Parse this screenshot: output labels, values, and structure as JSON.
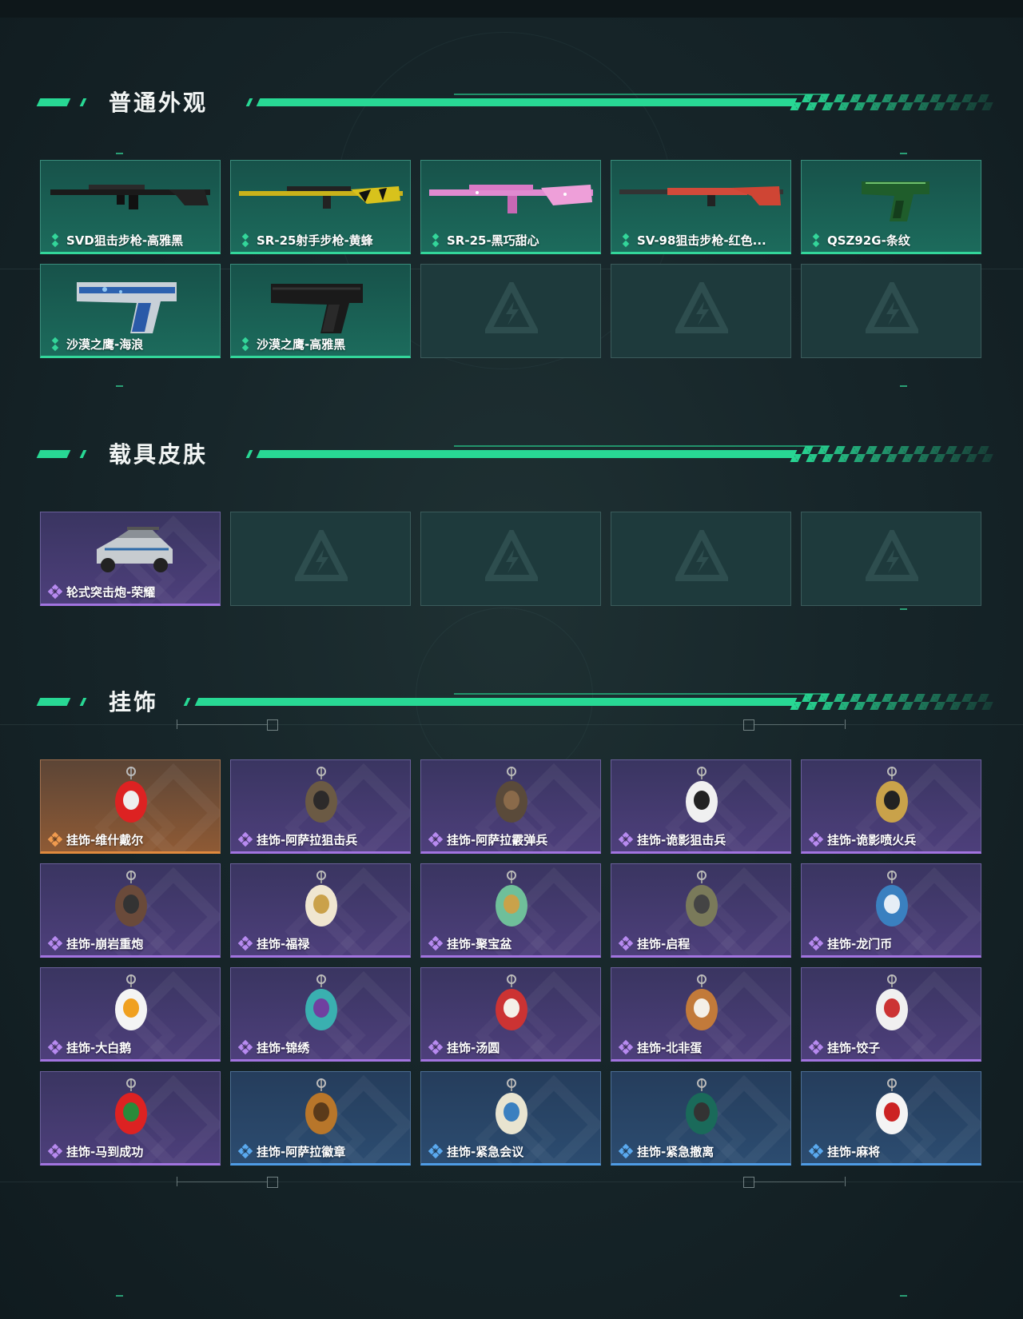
{
  "sections": {
    "weapon": {
      "title": "普通外观",
      "items": [
        {
          "label": "SVD狙击步枪-高雅黑",
          "rarity": "green",
          "icon": "svd-rifle-icon"
        },
        {
          "label": "SR-25射手步枪-黄蜂",
          "rarity": "green",
          "icon": "sr25-rifle-icon"
        },
        {
          "label": "SR-25-黑巧甜心",
          "rarity": "green",
          "icon": "sr25-pink-rifle-icon"
        },
        {
          "label": "SV-98狙击步枪-红色...",
          "rarity": "green",
          "icon": "sv98-rifle-icon"
        },
        {
          "label": "QSZ92G-条纹",
          "rarity": "green",
          "icon": "pistol-icon"
        },
        {
          "label": "沙漠之鹰-海浪",
          "rarity": "green",
          "icon": "desert-eagle-icon"
        },
        {
          "label": "沙漠之鹰-高雅黑",
          "rarity": "green",
          "icon": "desert-eagle-icon"
        }
      ]
    },
    "vehicle": {
      "title": "载具皮肤",
      "items": [
        {
          "label": "轮式突击炮-荣耀",
          "rarity": "purple",
          "icon": "armored-vehicle-icon"
        }
      ]
    },
    "charm": {
      "title": "挂饰",
      "items": [
        {
          "label": "挂饰-维什戴尔",
          "rarity": "orange",
          "icon": "charm-icon"
        },
        {
          "label": "挂饰-阿萨拉狙击兵",
          "rarity": "purple",
          "icon": "charm-icon"
        },
        {
          "label": "挂饰-阿萨拉霰弹兵",
          "rarity": "purple",
          "icon": "charm-icon"
        },
        {
          "label": "挂饰-诡影狙击兵",
          "rarity": "purple",
          "icon": "charm-icon"
        },
        {
          "label": "挂饰-诡影喷火兵",
          "rarity": "purple",
          "icon": "charm-icon"
        },
        {
          "label": "挂饰-崩岩重炮",
          "rarity": "purple",
          "icon": "charm-icon"
        },
        {
          "label": "挂饰-福禄",
          "rarity": "purple",
          "icon": "charm-icon"
        },
        {
          "label": "挂饰-聚宝盆",
          "rarity": "purple",
          "icon": "charm-icon"
        },
        {
          "label": "挂饰-启程",
          "rarity": "purple",
          "icon": "charm-icon"
        },
        {
          "label": "挂饰-龙门币",
          "rarity": "purple",
          "icon": "charm-icon"
        },
        {
          "label": "挂饰-大白鹅",
          "rarity": "purple",
          "icon": "charm-icon"
        },
        {
          "label": "挂饰-锦绣",
          "rarity": "purple",
          "icon": "charm-icon"
        },
        {
          "label": "挂饰-汤圆",
          "rarity": "purple",
          "icon": "charm-icon"
        },
        {
          "label": "挂饰-北非蛋",
          "rarity": "purple",
          "icon": "charm-icon"
        },
        {
          "label": "挂饰-饺子",
          "rarity": "purple",
          "icon": "charm-icon"
        },
        {
          "label": "挂饰-马到成功",
          "rarity": "purple",
          "icon": "charm-icon"
        },
        {
          "label": "挂饰-阿萨拉徽章",
          "rarity": "blue",
          "icon": "charm-icon"
        },
        {
          "label": "挂饰-紧急会议",
          "rarity": "blue",
          "icon": "charm-icon"
        },
        {
          "label": "挂饰-紧急撤离",
          "rarity": "blue",
          "icon": "charm-icon"
        },
        {
          "label": "挂饰-麻将",
          "rarity": "blue",
          "icon": "charm-icon"
        }
      ]
    }
  },
  "colors": {
    "accent": "#28d894",
    "green": "#33d69a",
    "purple": "#a274e0",
    "blue": "#4e9ce6",
    "orange": "#e08a3e"
  }
}
